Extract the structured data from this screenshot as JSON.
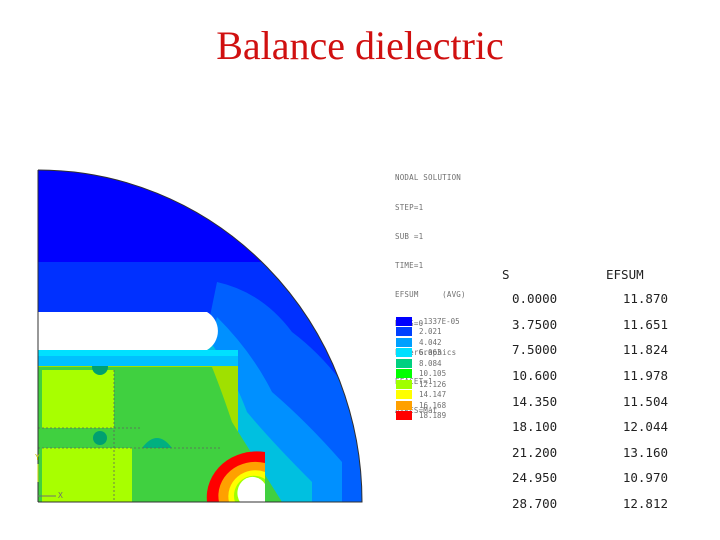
{
  "slide": {
    "title": "Balance dielectric"
  },
  "plot": {
    "ansys_text_lines": [
      "NODAL SOLUTION",
      "STEP=1",
      "SUB =1",
      "TIME=1",
      "EFSUM     (AVG)",
      "RSYS=0",
      "PowerGraphics",
      "EFACET=1",
      "AVRES=Mat"
    ],
    "legend": [
      {
        "value": ".1337E-05",
        "color": "#0000ff"
      },
      {
        "value": "2.021",
        "color": "#0040ff"
      },
      {
        "value": "4.042",
        "color": "#00a0ff"
      },
      {
        "value": "6.063",
        "color": "#00e0ff"
      },
      {
        "value": "8.084",
        "color": "#00d080"
      },
      {
        "value": "10.105",
        "color": "#00ff00"
      },
      {
        "value": "12.126",
        "color": "#a0ff00"
      },
      {
        "value": "14.147",
        "color": "#ffff00"
      },
      {
        "value": "16.168",
        "color": "#ffa000"
      },
      {
        "value": "18.189",
        "color": "#ff0000"
      }
    ],
    "axis_labels": {
      "y": "Y",
      "x": "X"
    }
  },
  "table": {
    "headers": [
      "S",
      "EFSUM"
    ],
    "rows": [
      [
        "0.0000",
        "11.870"
      ],
      [
        "3.7500",
        "11.651"
      ],
      [
        "7.5000",
        "11.824"
      ],
      [
        "10.600",
        "11.978"
      ],
      [
        "14.350",
        "11.504"
      ],
      [
        "18.100",
        "12.044"
      ],
      [
        "21.200",
        "13.160"
      ],
      [
        "24.950",
        "10.970"
      ],
      [
        "28.700",
        "12.812"
      ]
    ]
  }
}
